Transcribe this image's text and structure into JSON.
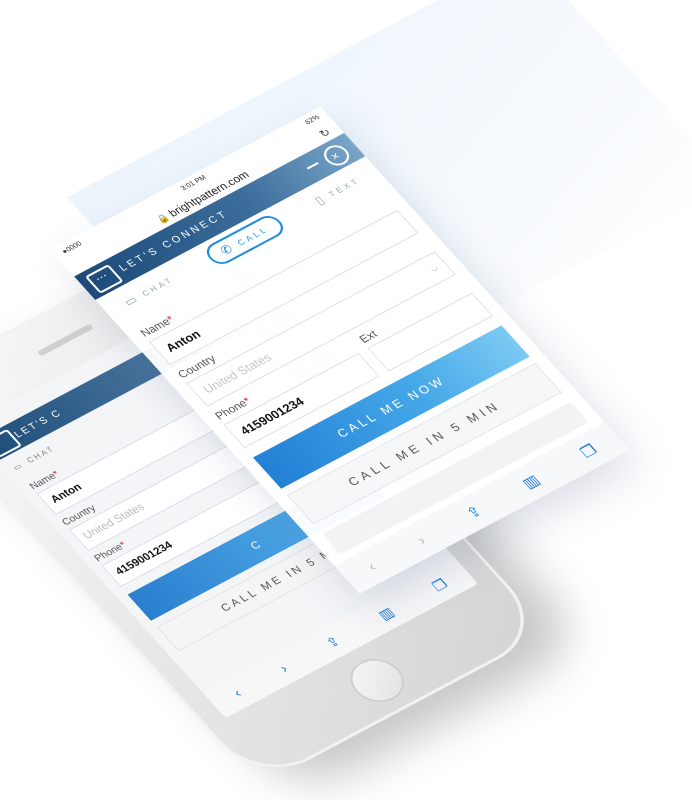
{
  "status": {
    "carrier": "●0000",
    "time": "3:01 PM",
    "battery": "62%"
  },
  "browser": {
    "url": "brightpattern.com",
    "reload_icon": "reload-icon",
    "lock_icon": "lock-icon"
  },
  "widget": {
    "title": "LET'S CONNECT",
    "tabs": [
      {
        "label": "CHAT",
        "icon": "chat-icon"
      },
      {
        "label": "CALL",
        "icon": "phone-icon"
      },
      {
        "label": "TEXT",
        "icon": "text-icon"
      }
    ],
    "form": {
      "name_label": "Name",
      "name_value": "Anton",
      "country_label": "Country",
      "country_value": "United States",
      "phone_label": "Phone",
      "phone_value": "4159001234",
      "ext_label": "Ext",
      "required_mark": "*"
    },
    "buttons": {
      "call_now": "CALL ME NOW",
      "call_later": "CALL ME IN 5 MIN"
    }
  },
  "back_screen": {
    "title": "LET'S C",
    "tab": "CHAT",
    "name_label": "Name",
    "name_value": "Anton",
    "country_label": "Country",
    "country_value": "United States",
    "phone_label": "Phone",
    "phone_value": "4159001234",
    "call_later": "CALL ME IN 5 MIN"
  },
  "toolbar": {
    "back": "‹",
    "forward": "›",
    "share_icon": "share-icon",
    "bookmarks_icon": "bookmarks-icon",
    "tabs_icon": "tabs-icon"
  },
  "colors": {
    "header": "#1d4a78",
    "accent": "#1f8ee0",
    "button": "#2380d6",
    "required": "#e02424"
  }
}
